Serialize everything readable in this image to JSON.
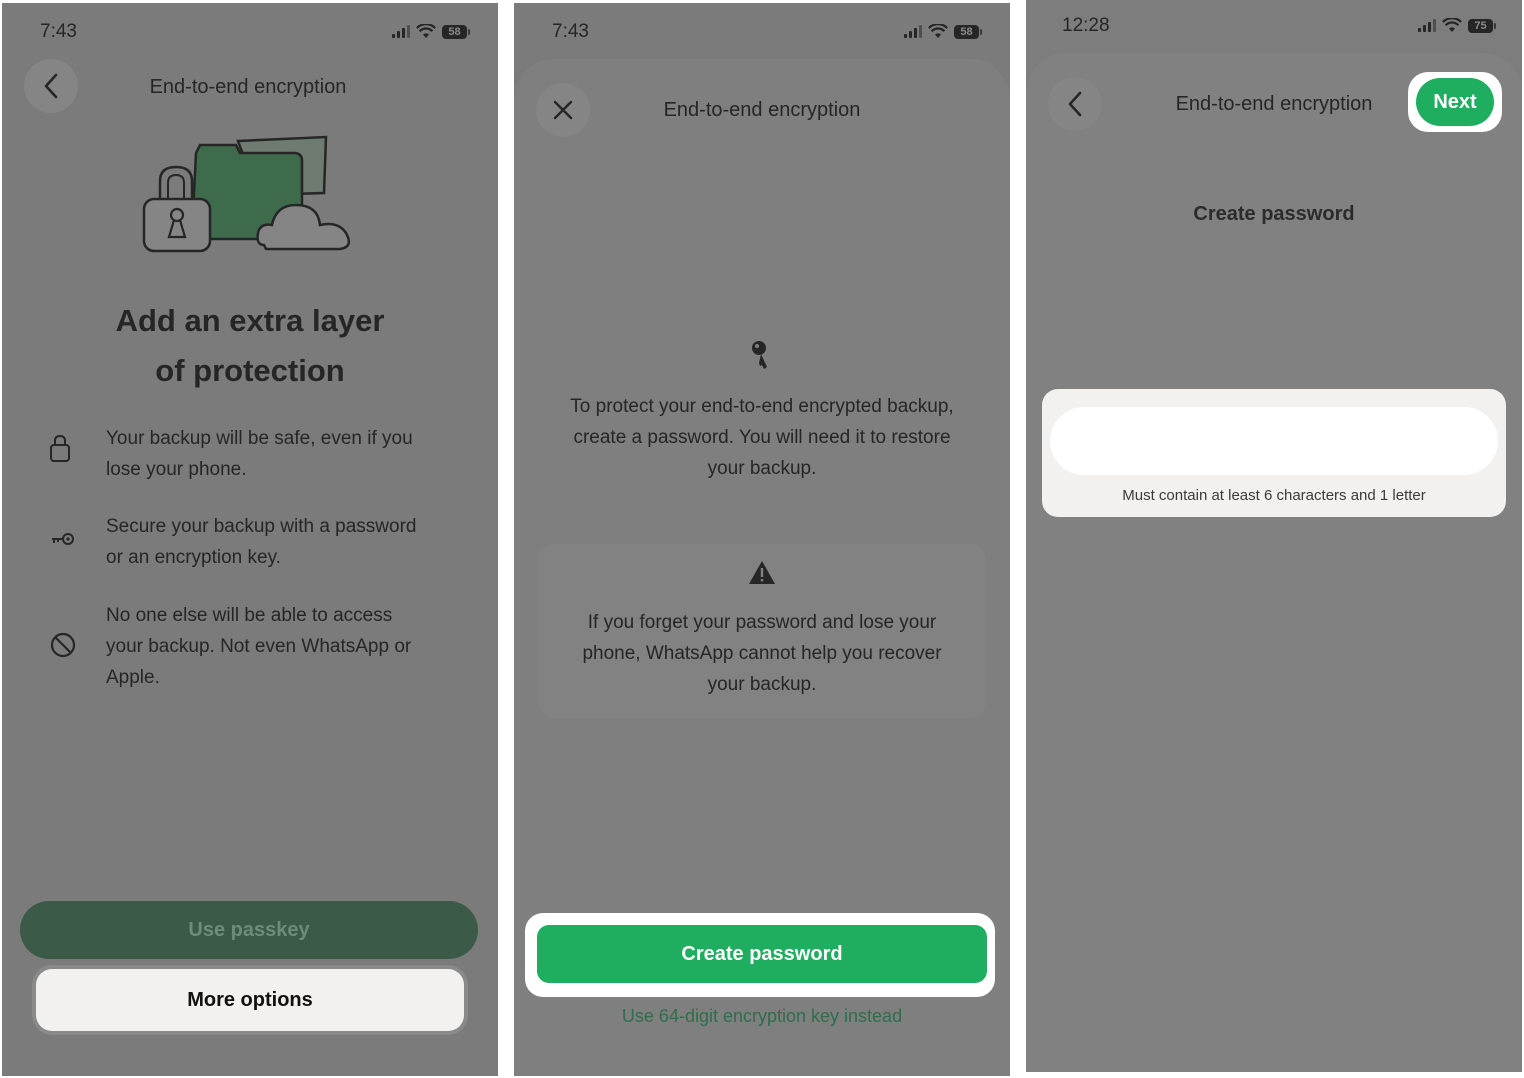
{
  "screen1": {
    "status": {
      "time": "7:43",
      "battery": "58"
    },
    "title": "End-to-end encryption",
    "heading_line1": "Add an extra layer",
    "heading_line2": "of protection",
    "features": [
      {
        "icon": "lock-icon",
        "line1": "Your backup will be safe, even if you",
        "line2": "lose your phone.",
        "line3": ""
      },
      {
        "icon": "key-icon",
        "line1": "Secure your backup with a password",
        "line2": "or an encryption key.",
        "line3": ""
      },
      {
        "icon": "prohibited-icon",
        "line1": "No one else will be able to access",
        "line2": "your backup. Not even WhatsApp or",
        "line3": "Apple."
      }
    ],
    "primary_button": "Use passkey",
    "secondary_button": "More options"
  },
  "screen2": {
    "status": {
      "time": "7:43",
      "battery": "58"
    },
    "title": "End-to-end encryption",
    "body_line1": "To protect your end-to-end encrypted backup,",
    "body_line2": "create a password. You will need it to restore",
    "body_line3": "your backup.",
    "warning_line1": "If you forget your password and lose your",
    "warning_line2": "phone, WhatsApp cannot help you recover",
    "warning_line3": "your backup.",
    "primary_button": "Create password",
    "link": "Use 64-digit encryption key instead"
  },
  "screen3": {
    "status": {
      "time": "12:28",
      "battery": "75"
    },
    "title": "End-to-end encryption",
    "next_button": "Next",
    "subtitle": "Create password",
    "password_value": "",
    "hint": "Must contain at least 6 characters and 1 letter"
  },
  "colors": {
    "whatsapp_green": "#1fae5f",
    "dimmed_green": "#3b5a47",
    "link_green": "#2f6e4a",
    "overlay_gray": "#7b7b7b"
  }
}
